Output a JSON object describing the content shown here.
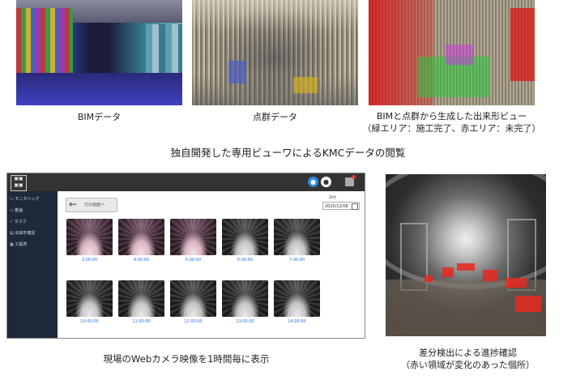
{
  "top_images": [
    {
      "caption": "BIMデータ"
    },
    {
      "caption": "点群データ"
    },
    {
      "caption_line1": "BIMと点群から生成した出来形ビュー",
      "caption_line2": "（緑エリア：施工完了、赤エリア：未完了）"
    }
  ],
  "section_heading": "独自開発した専用ビューワによるKMCデータの閲覧",
  "app": {
    "sidebar": {
      "items": [
        {
          "label": "モニタリング",
          "icon": "monitor-icon"
        },
        {
          "label": "動画",
          "icon": "video-icon"
        },
        {
          "label": "タスク",
          "icon": "check-icon"
        },
        {
          "label": "出来形確認",
          "icon": "chart-icon"
        },
        {
          "label": "工程表",
          "icon": "calendar-icon"
        }
      ]
    },
    "back_button": "元の画面へ",
    "date_label": "日付",
    "date_value": "2020/12/08",
    "thumbnails": [
      {
        "time": "3:00:00"
      },
      {
        "time": "4:00:00"
      },
      {
        "time": "5:00:00"
      },
      {
        "time": "6:00:00"
      },
      {
        "time": "7:00:00"
      },
      {
        "time": "10:00:00"
      },
      {
        "time": "11:00:00"
      },
      {
        "time": "12:00:00"
      },
      {
        "time": "13:00:00"
      },
      {
        "time": "14:00:00"
      }
    ],
    "colors": {
      "topbar": "#333333",
      "sidebar": "#1e2a3a",
      "accent": "#2a6fd6",
      "notification": "#e04040"
    }
  },
  "bottom_left_caption": "現場のWebカメラ映像を1時間毎に表示",
  "bottom_right_caption_line1": "差分検出による進捗確認",
  "bottom_right_caption_line2": "（赤い領域が変化のあった個所）"
}
